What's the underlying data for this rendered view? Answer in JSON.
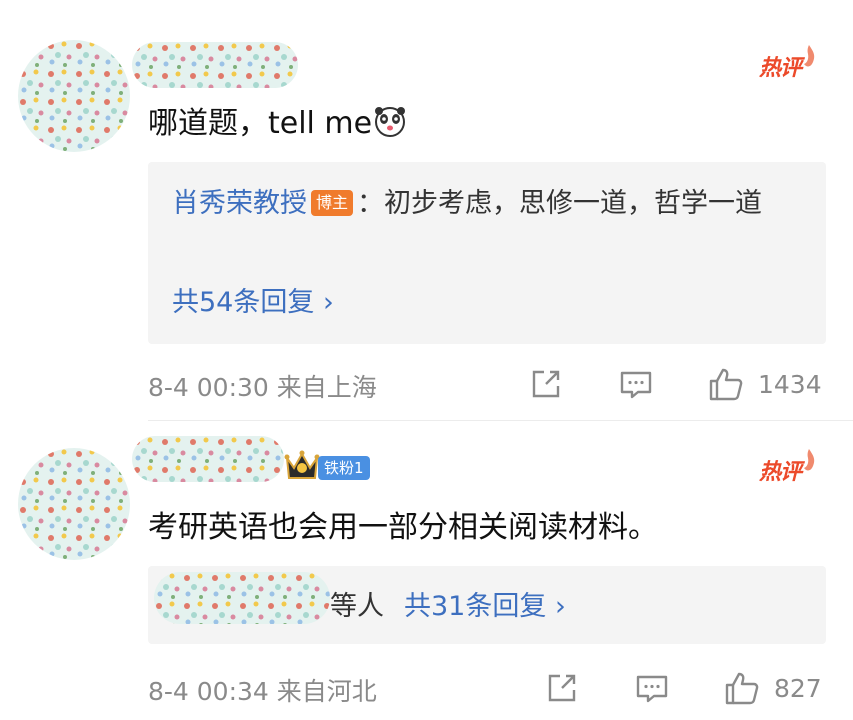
{
  "comments": [
    {
      "hot_label": "热评",
      "text": "哪道题，tell me",
      "reply_preview": {
        "author": "肖秀荣教授",
        "author_badge": "博主",
        "content": "：初步考虑，思修一道，哲学一道",
        "count_label": "共54条回复 ›"
      },
      "time_location": "8-4 00:30 来自上海",
      "likes": "1434"
    },
    {
      "hot_label": "热评",
      "fan_badge": "铁粉1",
      "text": "考研英语也会用一部分相关阅读材料。",
      "reply_preview": {
        "others_label": "等人",
        "count_label": "共31条回复 ›"
      },
      "time_location": "8-4 00:34 来自河北",
      "likes": "827"
    }
  ],
  "icons": {
    "share": "share-icon",
    "reply": "comment-icon",
    "like": "thumbs-up-icon",
    "crown": "crown-icon",
    "emoji": "panda-face-emoji",
    "flame": "flame-icon"
  },
  "colors": {
    "link": "#3d6fbf",
    "hot": "#ec4a2a",
    "host_badge": "#f07b2c",
    "fan_badge": "#4a90e2",
    "meta": "#8a8a8a",
    "reply_bg": "#f4f4f4"
  }
}
